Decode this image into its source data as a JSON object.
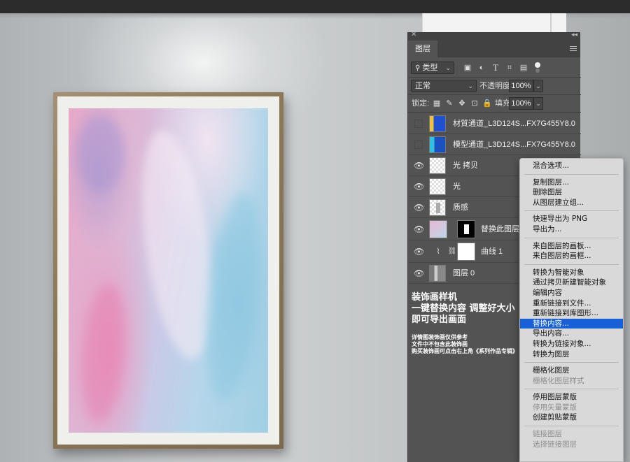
{
  "panel": {
    "tab_label": "图层",
    "filter_kind": "类型",
    "blend_mode": "正常",
    "opacity_label": "不透明度:",
    "opacity_value": "100%",
    "lock_label": "锁定:",
    "fill_label": "填充:",
    "fill_value": "100%"
  },
  "layers": [
    {
      "name": "材質通道_L3D124S...FX7G455Y8.0",
      "visible": false
    },
    {
      "name": "模型通道_L3D124S...FX7G455Y8.0",
      "visible": false
    },
    {
      "name": "光 拷贝",
      "visible": true
    },
    {
      "name": "光",
      "visible": true
    },
    {
      "name": "质感",
      "visible": true
    },
    {
      "name": "替换此图层内",
      "visible": true
    },
    {
      "name": "曲线 1",
      "visible": true
    },
    {
      "name": "图层 0",
      "visible": true
    }
  ],
  "promo": {
    "line1": "装饰画样机",
    "line2": "一键替换内容 调整好大小",
    "line3": "即可导出画面",
    "note1": "详情图装饰画仅供参考",
    "note2": "文件中不包含此装饰画",
    "note3": "购买装饰画可点击右上角《系列作品专辑》"
  },
  "context_menu": {
    "groups": [
      [
        {
          "label": "混合选项...",
          "disabled": false
        }
      ],
      [
        {
          "label": "复制图层...",
          "disabled": false
        },
        {
          "label": "删除图层",
          "disabled": false
        },
        {
          "label": "从图层建立组...",
          "disabled": false
        }
      ],
      [
        {
          "label": "快速导出为 PNG",
          "disabled": false
        },
        {
          "label": "导出为...",
          "disabled": false
        }
      ],
      [
        {
          "label": "来自图层的画板...",
          "disabled": false
        },
        {
          "label": "来自图层的画框...",
          "disabled": false
        }
      ],
      [
        {
          "label": "转换为智能对象",
          "disabled": false
        },
        {
          "label": "通过拷贝新建智能对象",
          "disabled": false
        },
        {
          "label": "编辑内容",
          "disabled": false
        },
        {
          "label": "重新链接到文件...",
          "disabled": false
        },
        {
          "label": "重新链接到库图形...",
          "disabled": false
        },
        {
          "label": "替换内容...",
          "disabled": false,
          "highlighted": true
        },
        {
          "label": "导出内容...",
          "disabled": false
        },
        {
          "label": "转换为链接对象...",
          "disabled": false
        },
        {
          "label": "转换为图层",
          "disabled": false
        }
      ],
      [
        {
          "label": "栅格化图层",
          "disabled": false
        },
        {
          "label": "栅格化图层样式",
          "disabled": true
        }
      ],
      [
        {
          "label": "停用图层蒙版",
          "disabled": false
        },
        {
          "label": "停用矢量蒙版",
          "disabled": true
        },
        {
          "label": "创建剪贴蒙版",
          "disabled": false
        }
      ],
      [
        {
          "label": "链接图层",
          "disabled": true
        },
        {
          "label": "选择链接图层",
          "disabled": true
        }
      ]
    ]
  },
  "colors": {
    "panel_bg": "#535353",
    "menu_bg": "#d9d9d9",
    "highlight": "#1760d7"
  }
}
